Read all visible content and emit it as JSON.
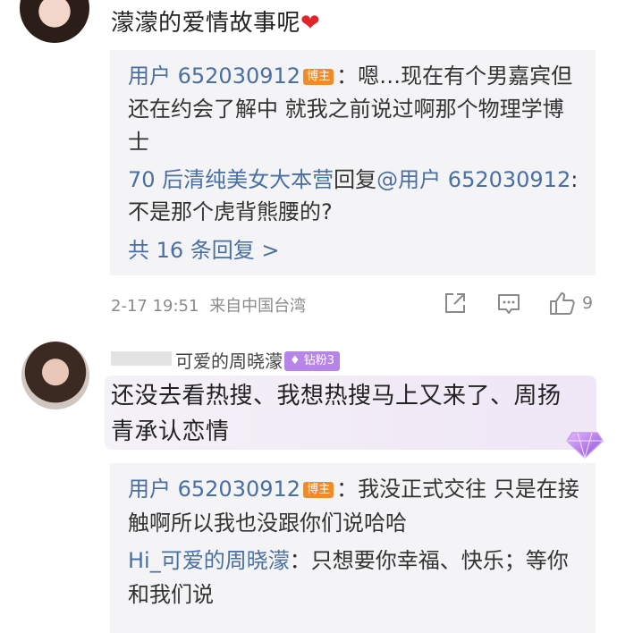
{
  "comment1": {
    "text": "濛濛的爱情故事呢",
    "emoji_heart": "❤",
    "replies": [
      {
        "user": "用户 652030912",
        "badge": "博主",
        "text": "：嗯…现在有个男嘉宾但还在约会了解中 就我之前说过啊那个物理学博士"
      },
      {
        "user": "70 后清纯美女大本营",
        "reply_word": "回复",
        "at_user": "@用户 652030912",
        "text": ":不是那个虎背熊腰的?"
      }
    ],
    "more_replies": "共 16 条回复 >",
    "timestamp": "2-17 19:51",
    "source": "来自中国台湾",
    "like_count": "9"
  },
  "comment2": {
    "name_visible": "可爱的周晓濛",
    "fan_badge": "钻粉3",
    "text": "还没去看热搜、我想热搜马上又来了、周扬青承认恋情",
    "replies": [
      {
        "user": "用户 652030912",
        "badge": "博主",
        "text": "：我没正式交往 只是在接触啊所以我也没跟你们说哈哈"
      },
      {
        "user": "Hi_可爱的周晓濛",
        "text": "：只想要你幸福、快乐；等你和我们说"
      }
    ]
  },
  "colors": {
    "link_blue": "#4a6fa3",
    "badge_orange": "#f08a2a",
    "fan_purple": "#b784ea",
    "reply_bg": "#f4f4f6"
  }
}
